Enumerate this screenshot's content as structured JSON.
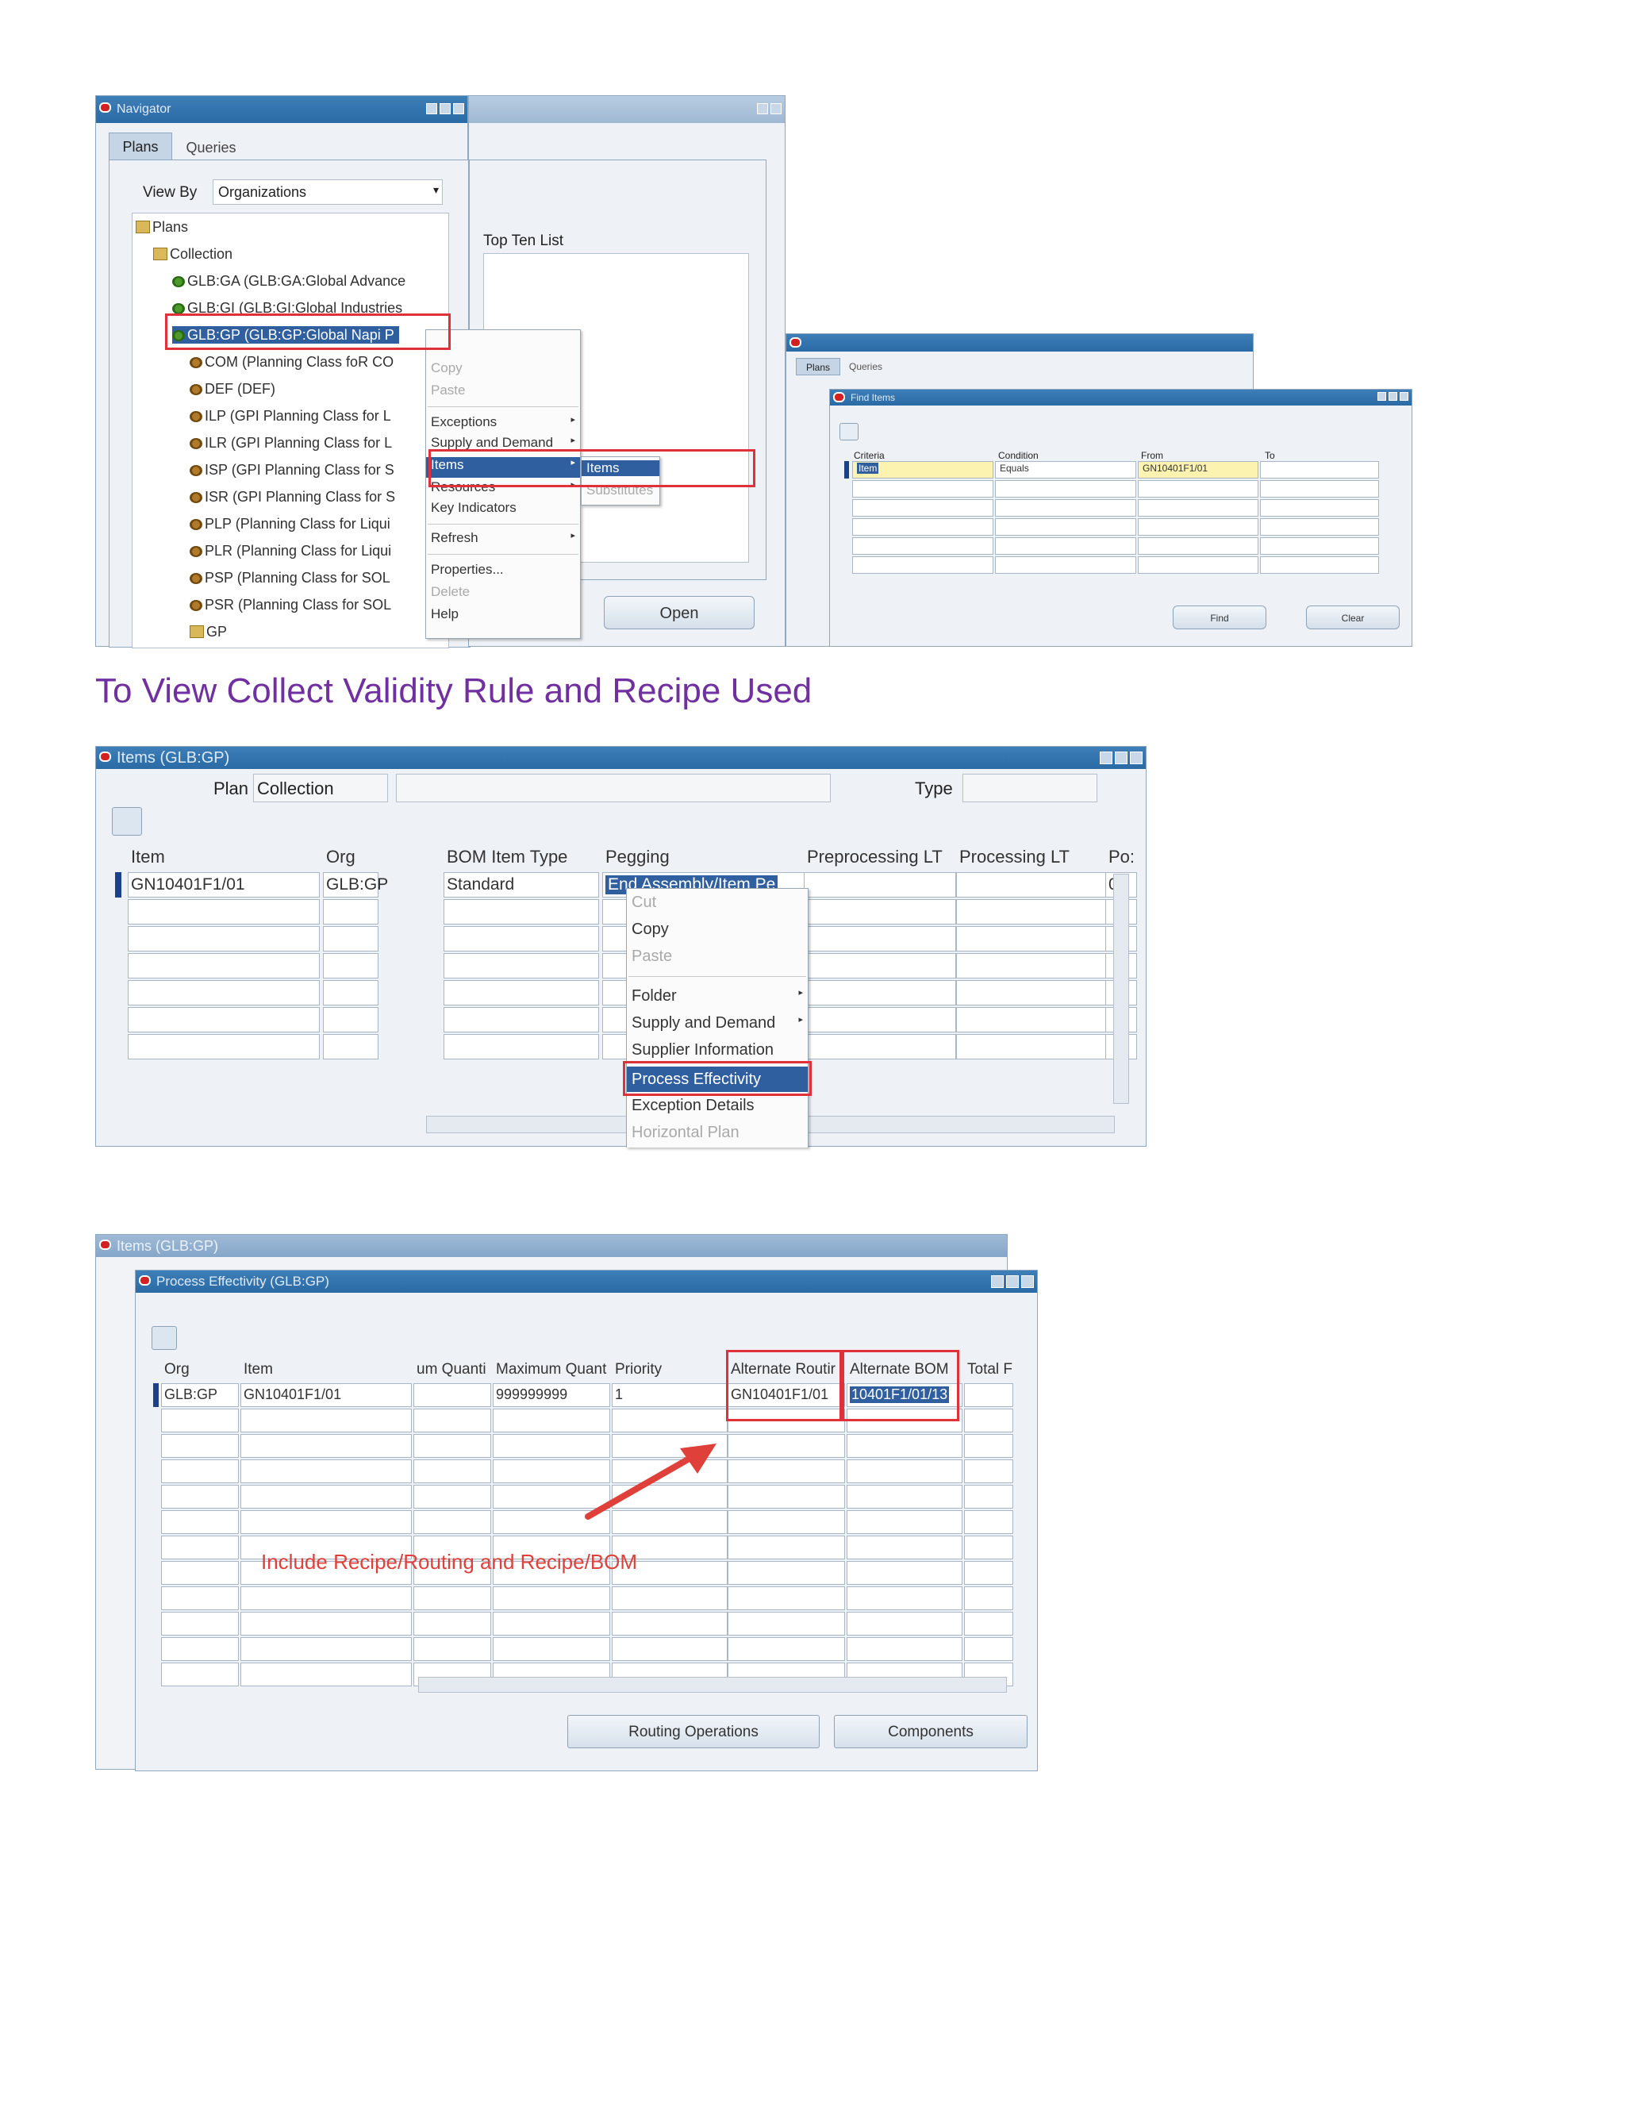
{
  "screenshot1": {
    "navigator": {
      "title": "Navigator",
      "tabs": [
        "Plans",
        "Queries"
      ],
      "view_by_label": "View By",
      "view_by_value": "Organizations",
      "tree": [
        "Plans",
        "Collection",
        "GLB:GA (GLB:GA:Global Advance",
        "GLB:GI (GLB:GI:Global Industries",
        "GLB:GP (GLB:GP:Global Napi P",
        "COM (Planning Class foR CO",
        "DEF (DEF)",
        "ILP (GPI Planning Class for L",
        "ILR (GPI Planning Class for L",
        "ISP (GPI Planning Class for S",
        "ISR (GPI Planning Class for S",
        "PLP (Planning Class for Liqui",
        "PLR (Planning Class for Liqui",
        "PSP (Planning Class for SOL",
        "PSR (Planning Class for SOL",
        "GP"
      ],
      "top_ten_label": "Top Ten List",
      "open_button": "Open"
    },
    "context_menu": {
      "items": [
        "Copy",
        "Paste",
        "Exceptions",
        "Supply and Demand",
        "Items",
        "Resources",
        "Key Indicators",
        "Refresh",
        "Properties...",
        "Delete",
        "Help"
      ]
    },
    "submenu": {
      "items": [
        "Items",
        "Substitutes"
      ]
    },
    "find_items": {
      "title": "Find Items",
      "tabs": [
        "Plans",
        "Queries"
      ],
      "columns": [
        "Criteria",
        "Condition",
        "From",
        "To"
      ],
      "row1": {
        "criteria": "Item",
        "condition": "Equals",
        "from": "GN10401F1/01",
        "to": ""
      },
      "find_button": "Find",
      "clear_button": "Clear"
    }
  },
  "section_title": "To View Collect Validity Rule and Recipe Used",
  "screenshot2": {
    "title": "Items (GLB:GP)",
    "plan_label": "Plan",
    "plan_value": "Collection",
    "type_label": "Type",
    "columns": [
      "Item",
      "Org",
      "BOM Item Type",
      "Pegging",
      "Preprocessing LT",
      "Processing LT",
      "Po:"
    ],
    "row1": {
      "item": "GN10401F1/01",
      "org": "GLB:GP",
      "bom": "Standard",
      "pegging": "End Assembly/Item Pe",
      "pre": "",
      "proc": "",
      "po": "0"
    },
    "context_menu": [
      "Cut",
      "Copy",
      "Paste",
      "Folder",
      "Supply and Demand",
      "Supplier Information",
      "Process Effectivity",
      "Exception Details",
      "Horizontal Plan"
    ]
  },
  "screenshot3": {
    "back_title": "Items (GLB:GP)",
    "title": "Process Effectivity (GLB:GP)",
    "columns": [
      "Org",
      "Item",
      "um Quanti",
      "Maximum Quant",
      "Priority",
      "Alternate Routir",
      "Alternate BOM",
      "Total F"
    ],
    "row1": {
      "org": "GLB:GP",
      "item": "GN10401F1/01",
      "min": "",
      "max": "999999999",
      "priority": "1",
      "alt_routing": "GN10401F1/01",
      "alt_bom": "10401F1/01/13",
      "total": ""
    },
    "annotation": "Include Recipe/Routing and Recipe/BOM",
    "routing_button": "Routing Operations",
    "components_button": "Components"
  }
}
